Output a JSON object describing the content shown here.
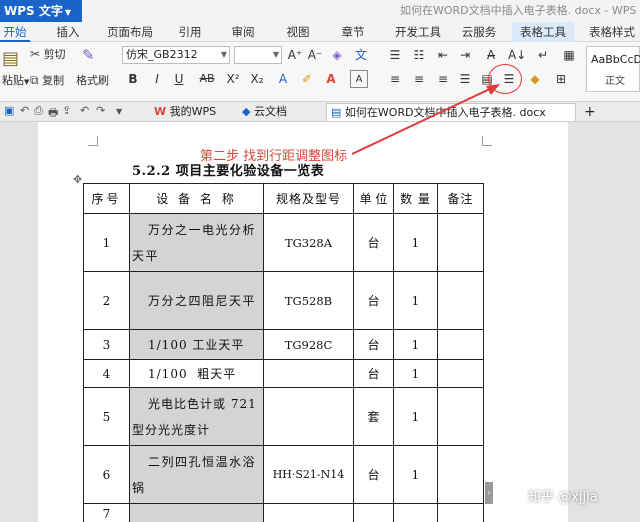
{
  "titlebar": {
    "app_button": "WPS 文字",
    "doc_title": "如何在WORD文档中插入电子表格. docx - WPS 文"
  },
  "ribbon_tabs": [
    "开始",
    "插入",
    "页面布局",
    "引用",
    "审阅",
    "视图",
    "章节",
    "开发工具",
    "云服务",
    "表格工具",
    "表格样式"
  ],
  "ribbon": {
    "cut": "剪切",
    "paste": "粘贴",
    "copy": "复制",
    "format_painter": "格式刷",
    "font_name": "仿宋_GB2312",
    "font_size": "",
    "style_sample": "AaBbCcD",
    "style_name": "正文"
  },
  "doc_tabs": {
    "tab1": "我的WPS",
    "tab2": "云文档",
    "tab3": "如何在WORD文档中插入电子表格. docx",
    "new_tab": "+"
  },
  "document": {
    "step_label": "第二步 找到行距调整图标",
    "table_title": "5.2.2 项目主要化验设备一览表",
    "headers": [
      "序号",
      "设 备 名 称",
      "规格及型号",
      "单 位",
      "数 量",
      "备注"
    ],
    "rows": [
      {
        "no": "1",
        "name": "万分之一电光分析天平",
        "spec": "TG328A",
        "unit": "台",
        "qty": "1",
        "note": ""
      },
      {
        "no": "2",
        "name": "万分之四阻尼天平",
        "spec": "TG528B",
        "unit": "台",
        "qty": "1",
        "note": ""
      },
      {
        "no": "3",
        "name": "1/100 工业天平",
        "spec": "TG928C",
        "unit": "台",
        "qty": "1",
        "note": ""
      },
      {
        "no": "4",
        "name": "1/100  粗天平",
        "spec": "",
        "unit": "台",
        "qty": "1",
        "note": ""
      },
      {
        "no": "5",
        "name": "光电比色计或 721型分光光度计",
        "spec": "",
        "unit": "套",
        "qty": "1",
        "note": ""
      },
      {
        "no": "6",
        "name": "二列四孔恒温水浴锅",
        "spec": "HH·S21-N14",
        "unit": "台",
        "qty": "1",
        "note": ""
      },
      {
        "no": "7",
        "name": "",
        "spec": "",
        "unit": "",
        "qty": "",
        "note": ""
      }
    ]
  },
  "watermark": "知乎 @xjjia",
  "colors": {
    "accent": "#1b63c6",
    "annotation": "#d9453b",
    "highlight_cell": "#d4d4d4"
  }
}
